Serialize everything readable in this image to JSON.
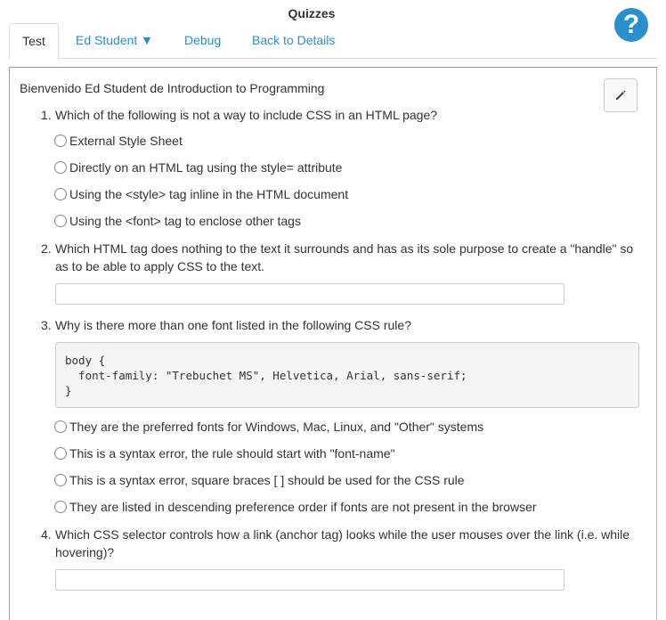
{
  "header": {
    "title": "Quizzes",
    "help_icon": "help-circle-icon",
    "help_symbol": "?"
  },
  "tabs": [
    {
      "label": "Test",
      "active": true
    },
    {
      "label": "Ed Student ▼",
      "active": false
    },
    {
      "label": "Debug",
      "active": false
    },
    {
      "label": "Back to Details",
      "active": false
    }
  ],
  "main": {
    "welcome": "Bienvenido Ed Student de Introduction to Programming",
    "edit_icon": "pencil-icon",
    "questions": [
      {
        "number": "1.",
        "text": "Which of the following is not a way to include CSS in an HTML page?",
        "options": [
          "External Style Sheet",
          "Directly on an HTML tag using the style= attribute",
          "Using the <style> tag inline in the HTML document",
          "Using the <font> tag to enclose other tags"
        ]
      },
      {
        "number": "2.",
        "text": "Which HTML tag does nothing to the text it surrounds and has as its sole purpose to create a \"handle\" so as to be able to apply CSS to the text.",
        "answer": ""
      },
      {
        "number": "3.",
        "text": "Why is there more than one font listed in the following CSS rule?",
        "code": "body {\n  font-family: \"Trebuchet MS\", Helvetica, Arial, sans-serif;\n}",
        "options": [
          "They are the preferred fonts for Windows, Mac, Linux, and \"Other\" systems",
          "This is a syntax error, the rule should start with \"font-name\"",
          "This is a syntax error, square braces [ ] should be used for the CSS rule",
          "They are listed in descending preference order if fonts are not present in the browser"
        ]
      },
      {
        "number": "4.",
        "text": "Which CSS selector controls how a link (anchor tag) looks while the user mouses over the link (i.e. while hovering)?",
        "answer": ""
      }
    ]
  },
  "colors": {
    "link": "#2a8fcf",
    "text": "#333333",
    "border": "#dddddd"
  }
}
